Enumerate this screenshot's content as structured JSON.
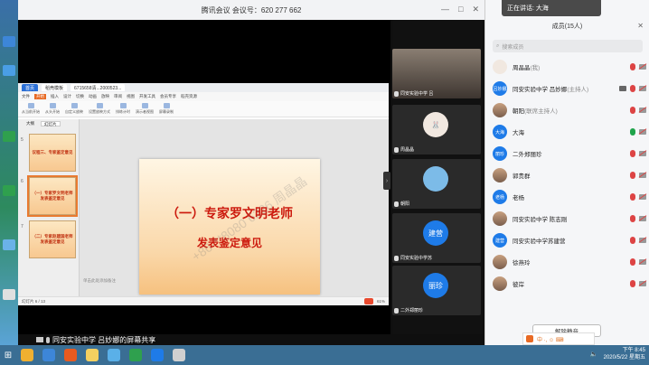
{
  "meeting": {
    "title": "腾讯会议 会议号：620 277 662",
    "window_min": "—",
    "window_max": "□",
    "window_close": "✕"
  },
  "share": {
    "wps_tab_home": "首页",
    "wps_tab_doc": "稻壳模板",
    "wps_tab_file": "6715658清...2000523...",
    "menu": [
      "文件",
      "开始",
      "插入",
      "设计",
      "切换",
      "动画",
      "放映",
      "审阅",
      "视图",
      "开发工具",
      "会员专享",
      "稻壳资源"
    ],
    "menu_active": "开始",
    "tools": [
      "从当前开始",
      "从头开始",
      "自定义放映",
      "设置放映方式",
      "排练计时",
      "演示者视图",
      "屏幕录制"
    ],
    "thumb_tabs": [
      "大纲",
      "幻灯片"
    ],
    "thumbs": [
      {
        "num": "5",
        "line1": "议程三、专家鉴定意见",
        "line2": ""
      },
      {
        "num": "6",
        "line1": "（一）专家罗文明老师",
        "line2": "发表鉴定意见"
      },
      {
        "num": "7",
        "line1": "（二）专家赵建国老师",
        "line2": "发表鉴定意见"
      }
    ],
    "slide_title": "（一）专家罗文明老师",
    "slide_subtitle": "发表鉴定意见",
    "watermark": "+86-**8080 6226 周晶晶",
    "notes_placeholder": "单击此处添加备注",
    "status_left": "幻灯片 6 / 13",
    "status_zoom": "61%"
  },
  "tiles": [
    {
      "name": "同安实验中学 吕",
      "type": "photo"
    },
    {
      "name": "周晶晶",
      "type": "bunny"
    },
    {
      "name": "朝阳",
      "type": "photo2"
    },
    {
      "name": "同安实验中学苏",
      "type": "circle",
      "circle_text": "建营"
    },
    {
      "name": "二外郑丽珍",
      "type": "circle",
      "circle_text": "丽珍"
    }
  ],
  "bottom_label": "同安实验中学 吕妙娜的屏幕共享",
  "members_panel": {
    "speaking": "正在讲话: 大海",
    "title": "成员(15人)",
    "close": "✕",
    "search_placeholder": "搜索成员",
    "mute_all": "解除静音",
    "list": [
      {
        "avatar": "",
        "name": "周晶晶",
        "role": "(我)",
        "style": "bunny",
        "mic": "off",
        "cam": "off"
      },
      {
        "avatar": "吕妙娜",
        "name": "同安实验中学 吕妙娜",
        "role": "(主持人)",
        "style": "blue",
        "mic": "off",
        "cam": "off",
        "screen": true
      },
      {
        "avatar": "",
        "name": "朝阳",
        "role": "(联席主持人)",
        "style": "photo",
        "mic": "off",
        "cam": "off"
      },
      {
        "avatar": "大海",
        "name": "大海",
        "role": "",
        "style": "blue",
        "mic": "on",
        "cam": "off"
      },
      {
        "avatar": "丽珍",
        "name": "二外郑丽珍",
        "role": "",
        "style": "blue",
        "mic": "off",
        "cam": "off"
      },
      {
        "avatar": "",
        "name": "郭贵群",
        "role": "",
        "style": "photo",
        "mic": "off",
        "cam": "off"
      },
      {
        "avatar": "老杨",
        "name": "老杨",
        "role": "",
        "style": "blue",
        "mic": "off",
        "cam": "off"
      },
      {
        "avatar": "",
        "name": "同安实验中学 陈志刚",
        "role": "",
        "style": "photo",
        "mic": "off",
        "cam": "off"
      },
      {
        "avatar": "建营",
        "name": "同安实验中学苏建营",
        "role": "",
        "style": "blue",
        "mic": "off",
        "cam": "off"
      },
      {
        "avatar": "",
        "name": "徐燕玲",
        "role": "",
        "style": "photo",
        "mic": "off",
        "cam": "off"
      },
      {
        "avatar": "",
        "name": "彼岸",
        "role": "",
        "style": "photo",
        "mic": "off",
        "cam": "off"
      }
    ]
  },
  "taskbar": {
    "time": "下午 8:45",
    "date": "2020/5/22 星期五",
    "ime": "中 ·, ☺ ⌨"
  },
  "colors": {
    "accent_blue": "#1e7be8",
    "slide_red": "#cc1a0e",
    "mic_on": "#1ea34a",
    "mic_off": "#dd4444"
  }
}
